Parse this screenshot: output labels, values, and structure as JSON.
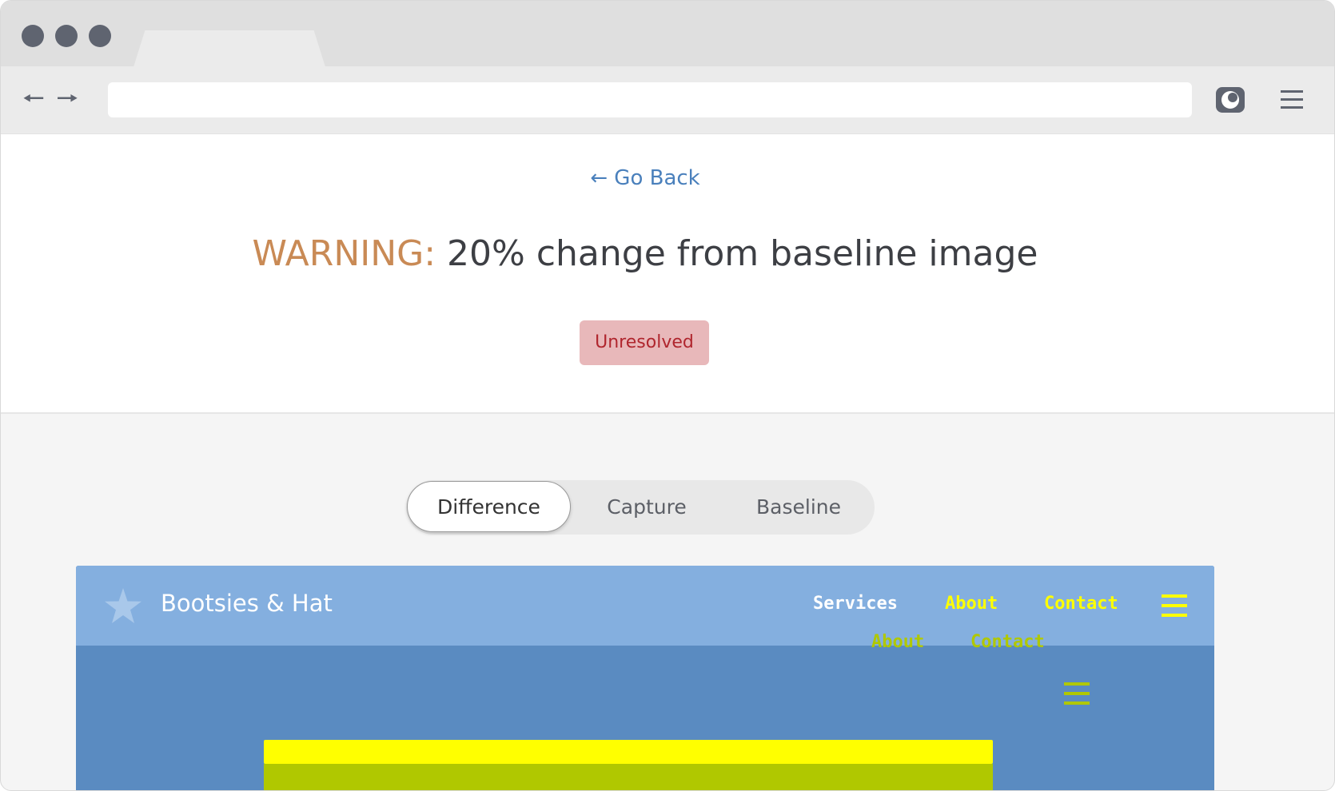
{
  "browser": {
    "url": "",
    "back_icon": "arrow-left-icon",
    "forward_icon": "arrow-right-icon",
    "eye_icon": "camera-eye-icon",
    "menu_icon": "hamburger-menu-icon"
  },
  "page": {
    "go_back_label": "← Go Back",
    "warning_label": "WARNING:",
    "warning_message": "20% change from baseline image",
    "status": "Unresolved"
  },
  "view_toggle": {
    "tabs": [
      "Difference",
      "Capture",
      "Baseline"
    ],
    "active": "Difference"
  },
  "preview_site": {
    "brand": "Bootsies & Hat",
    "nav_capture": [
      "Services",
      "About",
      "Contact"
    ],
    "nav_baseline": [
      "About",
      "Contact"
    ]
  },
  "colors": {
    "warning": "#c98a55",
    "badge_bg": "#e8b8ba",
    "badge_text": "#b0262e",
    "link": "#4a80bc",
    "preview_header": "#84afdf",
    "preview_body": "#5a8bc1",
    "diff_yellow": "#ffff00",
    "diff_olive": "#b0c800"
  }
}
